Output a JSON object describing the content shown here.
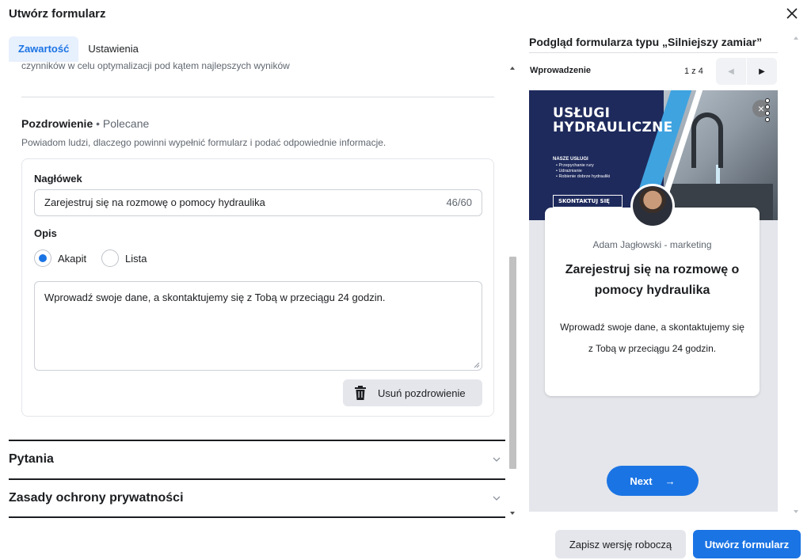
{
  "dialog": {
    "title": "Utwórz formularz"
  },
  "tabs": [
    {
      "label": "Zawartość",
      "active": true
    },
    {
      "label": "Ustawienia",
      "active": false
    }
  ],
  "content": {
    "clipped_text": "czynników w celu optymalizacji pod kątem najlepszych wyników",
    "greeting": {
      "title": "Pozdrowienie",
      "recommended": " • Polecane",
      "description": "Powiadom ludzi, dlaczego powinni wypełnić formularz i podać odpowiednie informacje.",
      "headline_label": "Nagłówek",
      "headline_value": "Zarejestruj się na rozmowę o pomocy hydraulika",
      "headline_counter": "46/60",
      "description_label": "Opis",
      "format_options": [
        {
          "label": "Akapit",
          "checked": true
        },
        {
          "label": "Lista",
          "checked": false
        }
      ],
      "description_value": "Wprowadź swoje dane, a skontaktujemy się z Tobą w przeciągu 24 godzin.",
      "delete_label": "Usuń pozdrowienie"
    },
    "accordions": [
      {
        "label": "Pytania"
      },
      {
        "label": "Zasady ochrony prywatności"
      }
    ]
  },
  "preview": {
    "title": "Podgląd formularza typu „Silniejszy zamiar”",
    "step_label": "Wprowadzenie",
    "step_count": "1 z 4",
    "banner": {
      "headline": "USŁUGI HYDRAULICZNE",
      "services_title": "NASZE USŁUGI",
      "services": [
        "• Przepychanie rury",
        "• Udrażnianie",
        "• Robienie dobrze hydrauliki"
      ],
      "cta": "SKONTAKTUJ SIĘ"
    },
    "card": {
      "page_name": "Adam Jagłowski - marketing",
      "headline": "Zarejestruj się na rozmowę o pomocy hydraulika",
      "description": "Wprowadź swoje dane, a skontaktujemy się z Tobą w przeciągu 24 godzin."
    },
    "next_label": "Next",
    "next_arrow": "→"
  },
  "footer": {
    "draft_label": "Zapisz wersję roboczą",
    "create_label": "Utwórz formularz"
  },
  "colors": {
    "accent": "#1b74e4",
    "tab_bg": "#e7f0fd",
    "neutral_btn": "#e4e6eb"
  },
  "icons": [
    "close-icon",
    "trash-icon",
    "chevron-down-icon",
    "chevron-left-icon",
    "chevron-right-icon"
  ]
}
